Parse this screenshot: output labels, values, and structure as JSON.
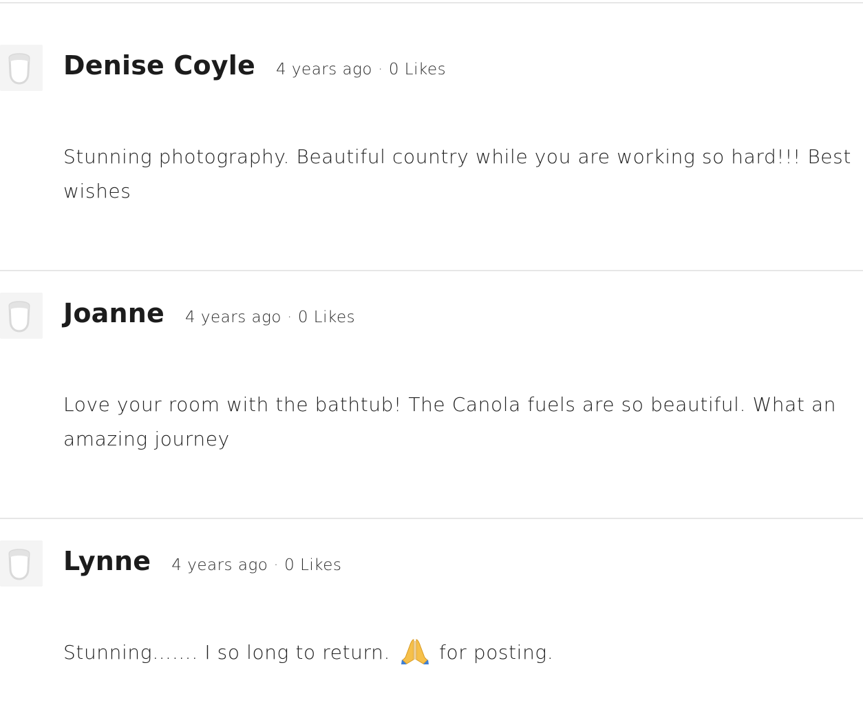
{
  "comments": [
    {
      "author": "Denise Coyle",
      "time": "4 years ago",
      "separator": "·",
      "likes": "0 Likes",
      "text": "Stunning photography. Beautiful country while you are working so hard!!! Best wishes"
    },
    {
      "author": "Joanne",
      "time": "4 years ago",
      "separator": "·",
      "likes": "0 Likes",
      "text": "Love your room with the bathtub! The Canola fuels are so beautiful. What an amazing journey"
    },
    {
      "author": "Lynne",
      "time": "4 years ago",
      "separator": "·",
      "likes": "0 Likes",
      "text_before_emoji": "Stunning……. I so long to return.",
      "emoji": "folded-hands-emoji",
      "text_after_emoji": "for posting."
    }
  ],
  "avatar_icon": "default-user-avatar-icon",
  "colors": {
    "divider": "#e6e6e6",
    "avatar_bg": "#f4f4f4",
    "text": "#1f1f1f"
  }
}
